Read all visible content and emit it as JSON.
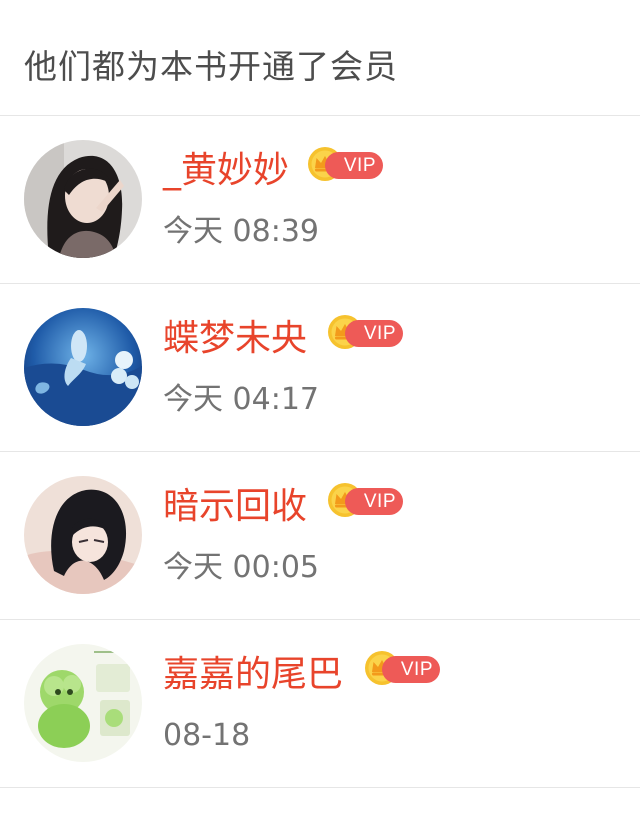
{
  "header": {
    "title": "他们都为本书开通了会员"
  },
  "members": [
    {
      "name": "_黄妙妙",
      "time": "今天 08:39",
      "badge": "VIP",
      "avatar_icon": "avatar-girl-photo"
    },
    {
      "name": "蝶梦未央",
      "time": "今天 04:17",
      "badge": "VIP",
      "avatar_icon": "avatar-underwater-scene"
    },
    {
      "name": "暗示回收",
      "time": "今天 00:05",
      "badge": "VIP",
      "avatar_icon": "avatar-anime-girl"
    },
    {
      "name": "嘉嘉的尾巴",
      "time": "08-18",
      "badge": "VIP",
      "avatar_icon": "avatar-green-plush"
    }
  ],
  "colors": {
    "name": "#e8442b",
    "time": "#737373",
    "title": "#4d4d4d",
    "vip_pill": "#ee5a57",
    "crown": "#f6c22e",
    "divider": "#e6e6e6"
  }
}
